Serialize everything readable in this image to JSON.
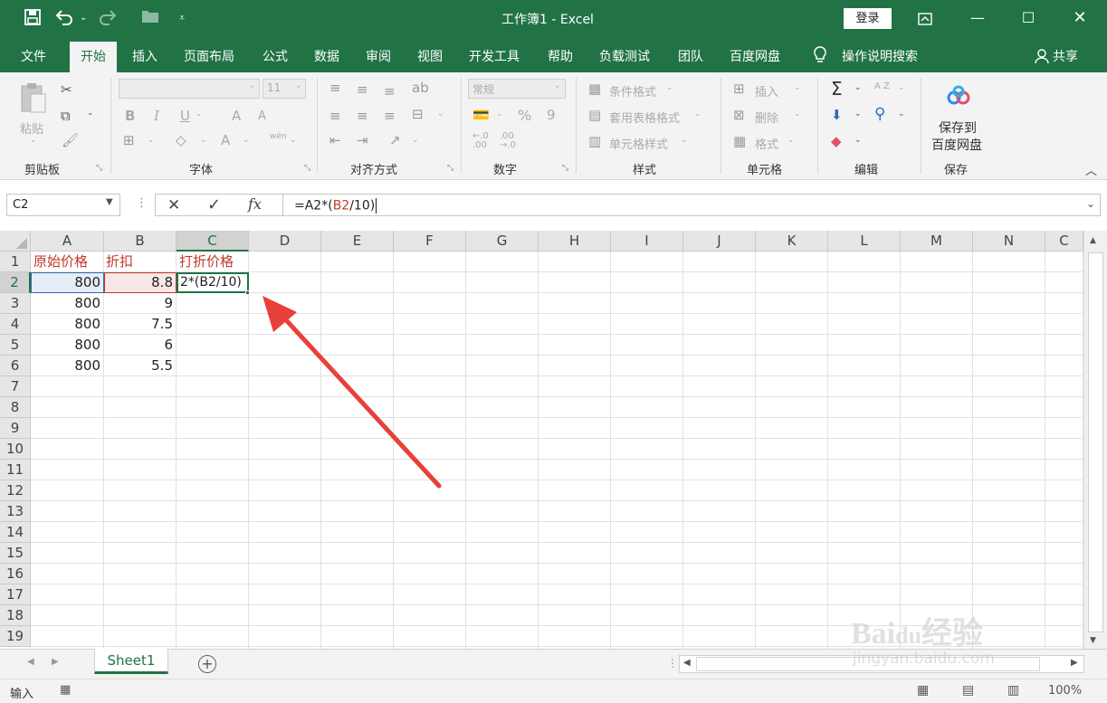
{
  "window": {
    "title": "工作簿1  -  Excel",
    "login_label": "登录",
    "ribbon_display_icon": "ribbon-display-options-icon",
    "minimize_icon": "minimize-icon",
    "restore_icon": "restore-icon",
    "close_icon": "close-icon"
  },
  "quick_access": {
    "save_icon": "save-icon",
    "undo_icon": "undo-icon",
    "redo_icon": "redo-icon",
    "open_icon": "open-folder-icon",
    "customize_icon": "customize-qat-icon"
  },
  "menu": {
    "items": [
      "文件",
      "开始",
      "插入",
      "页面布局",
      "公式",
      "数据",
      "审阅",
      "视图",
      "开发工具",
      "帮助",
      "负载测试",
      "团队",
      "百度网盘"
    ],
    "active": "开始",
    "search_label": "操作说明搜索",
    "share_label": "共享"
  },
  "ribbon": {
    "groups": {
      "clipboard": "剪贴板",
      "font": "字体",
      "alignment": "对齐方式",
      "number": "数字",
      "styles": "样式",
      "cells": "单元格",
      "editing": "编辑",
      "save": "保存"
    },
    "paste_label": "粘贴",
    "font_size": "11",
    "font_name": "",
    "bold": "B",
    "italic": "I",
    "underline": "U",
    "grow_font": "A",
    "shrink_font": "A",
    "font_color": "A",
    "phonetic": "wén",
    "number_format": "常规",
    "percent": "%",
    "comma": "9",
    "conditional_format": "条件格式",
    "table_format": "套用表格格式",
    "cell_styles": "单元格样式",
    "insert": "插入",
    "delete": "删除",
    "format": "格式",
    "sum": "Σ",
    "sort": "A Z",
    "baidu_save_line1": "保存到",
    "baidu_save_line2": "百度网盘"
  },
  "formula_bar": {
    "name_box": "C2",
    "cancel": "✕",
    "enter": "✓",
    "fx": "fx",
    "formula_parts": [
      "=A2*(",
      "B2",
      "/10)"
    ]
  },
  "sheet": {
    "columns": [
      "A",
      "B",
      "C",
      "D",
      "E",
      "F",
      "G",
      "H",
      "I",
      "J",
      "K",
      "L",
      "M",
      "N",
      "C"
    ],
    "rows": [
      "1",
      "2",
      "3",
      "4",
      "5",
      "6",
      "7",
      "8",
      "9",
      "10",
      "11",
      "12",
      "13",
      "14",
      "15",
      "16",
      "17",
      "18",
      "19"
    ],
    "selected_column": "C",
    "selected_row": "2",
    "headers": [
      "原始价格",
      "折扣",
      "打折价格"
    ],
    "data": [
      [
        "800",
        "8.8"
      ],
      [
        "800",
        "9"
      ],
      [
        "800",
        "7.5"
      ],
      [
        "800",
        "6"
      ],
      [
        "800",
        "5.5"
      ]
    ],
    "editing_cell_text": "2*(B2/10)"
  },
  "tabs": {
    "sheet_name": "Sheet1",
    "add_sheet": "+"
  },
  "status": {
    "mode": "输入",
    "zoom": "100%"
  },
  "colors": {
    "excel_green": "#217346",
    "ref_blue": "#2f6bb5",
    "ref_red": "#c0392b",
    "arrow_red": "#e8403a"
  }
}
